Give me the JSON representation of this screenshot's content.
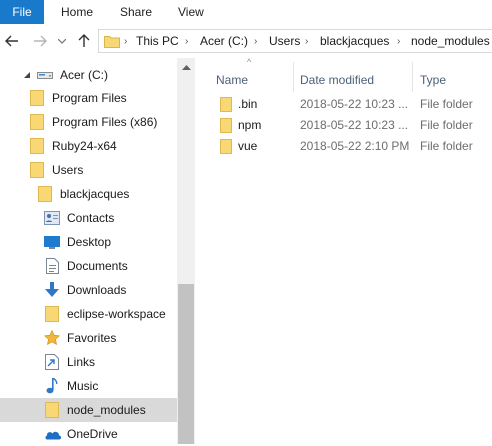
{
  "ribbon": {
    "tabs": [
      "File",
      "Home",
      "Share",
      "View"
    ]
  },
  "address_bar": {
    "crumbs": [
      "This PC",
      "Acer (C:)",
      "Users",
      "blackjacques",
      "node_modules"
    ]
  },
  "nav_pane": {
    "items": [
      {
        "label": "Acer (C:)",
        "icon": "drive-icon"
      },
      {
        "label": "Program Files",
        "icon": "folder-icon"
      },
      {
        "label": "Program Files (x86)",
        "icon": "folder-icon"
      },
      {
        "label": "Ruby24-x64",
        "icon": "folder-icon"
      },
      {
        "label": "Users",
        "icon": "folder-icon"
      },
      {
        "label": "blackjacques",
        "icon": "folder-icon"
      },
      {
        "label": "Contacts",
        "icon": "contacts-icon"
      },
      {
        "label": "Desktop",
        "icon": "desktop-icon"
      },
      {
        "label": "Documents",
        "icon": "documents-icon"
      },
      {
        "label": "Downloads",
        "icon": "downloads-icon"
      },
      {
        "label": "eclipse-workspace",
        "icon": "folder-icon"
      },
      {
        "label": "Favorites",
        "icon": "favorites-icon"
      },
      {
        "label": "Links",
        "icon": "links-icon"
      },
      {
        "label": "Music",
        "icon": "music-icon"
      },
      {
        "label": "node_modules",
        "icon": "folder-icon",
        "selected": true
      },
      {
        "label": "OneDrive",
        "icon": "onedrive-icon"
      }
    ]
  },
  "columns": {
    "name": "Name",
    "date": "Date modified",
    "type": "Type"
  },
  "files": [
    {
      "name": ".bin",
      "date": "2018-05-22 10:23 ...",
      "type": "File folder"
    },
    {
      "name": "npm",
      "date": "2018-05-22 10:23 ...",
      "type": "File folder"
    },
    {
      "name": "vue",
      "date": "2018-05-22 2:10 PM",
      "type": "File folder"
    }
  ],
  "colors": {
    "accent": "#1979ca",
    "folder": "#f8d775",
    "selection": "#d9d9d9",
    "header_text": "#4c607a"
  }
}
